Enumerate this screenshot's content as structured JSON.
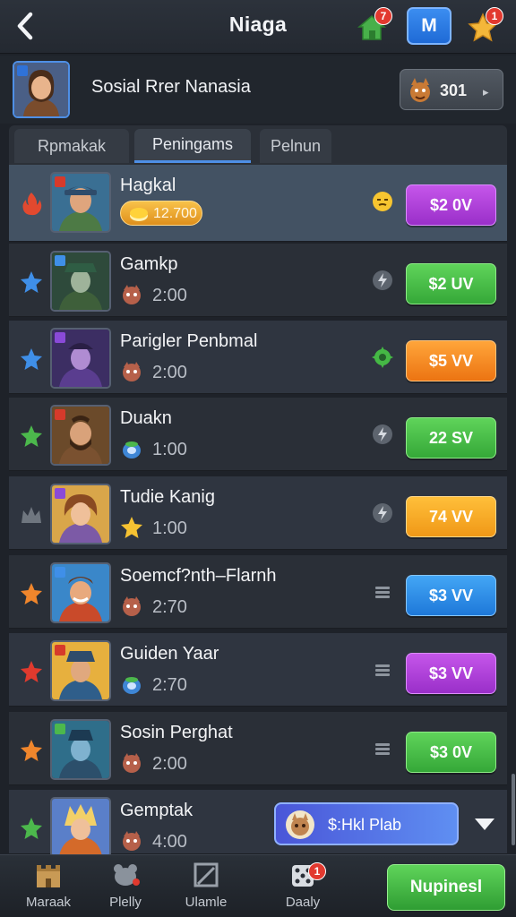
{
  "header": {
    "title": "Niaga",
    "home_badge": "7",
    "menu_label": "M",
    "star_badge": "1"
  },
  "profile": {
    "name": "Sosial Rrer Nanasia",
    "coins": "301",
    "coins_arrow": "▸"
  },
  "tabs": [
    {
      "label": "Rpmakak"
    },
    {
      "label": "Peningams",
      "active": true
    },
    {
      "label": "Pelnun"
    }
  ],
  "players": [
    {
      "name": "Hagkal",
      "value": "12.700",
      "price": "$2 0V",
      "button_color": "#b13ee0",
      "rank_icon": "fire-icon",
      "status_icon": "emoji-icon"
    },
    {
      "name": "Gamkp",
      "value": "2:00",
      "price": "$2 UV",
      "button_color": "#45bd45",
      "rank_icon": "blue-star-icon",
      "status_icon": "bolt-icon"
    },
    {
      "name": "Parigler Penbmal",
      "value": "2:00",
      "price": "$5 VV",
      "button_color": "#f48424",
      "rank_icon": "blue-star-icon",
      "status_icon": "gear-icon"
    },
    {
      "name": "Duakn",
      "value": "1:00",
      "price": "22 SV",
      "button_color": "#45bd45",
      "rank_icon": "green-star-icon",
      "status_icon": "bolt-icon"
    },
    {
      "name": "Tudie Kanig",
      "value": "1:00",
      "price": "74 VV",
      "button_color": "#f7a628",
      "rank_icon": "crown-icon",
      "status_icon": "bolt-icon"
    },
    {
      "name": "Soemcf?nth–Flarnh",
      "value": "2:70",
      "price": "$3 VV",
      "button_color": "#2f8ee8",
      "rank_icon": "orange-star-icon",
      "status_icon": "menu-icon"
    },
    {
      "name": "Guiden Yaar",
      "value": "2:70",
      "price": "$3 VV",
      "button_color": "#b13ee0",
      "rank_icon": "red-star-icon",
      "status_icon": "menu-icon"
    },
    {
      "name": "Sosin Perghat",
      "value": "2:00",
      "price": "$3 0V",
      "button_color": "#45bd45",
      "rank_icon": "orange-star-icon",
      "status_icon": "menu-icon"
    },
    {
      "name": "Gemptak",
      "value": "4:00",
      "rank_icon": "green-star-icon"
    }
  ],
  "promo": {
    "label": "$:Hkl Plab"
  },
  "bottom_nav": {
    "items": [
      {
        "label": "Maraak",
        "icon": "castle-icon"
      },
      {
        "label": "Plelly",
        "icon": "pet-icon"
      },
      {
        "label": "Ulamle",
        "icon": "frame-icon"
      },
      {
        "label": "Daaly",
        "icon": "dice-icon",
        "badge": "1"
      }
    ],
    "cta_label": "Nupinesl"
  }
}
